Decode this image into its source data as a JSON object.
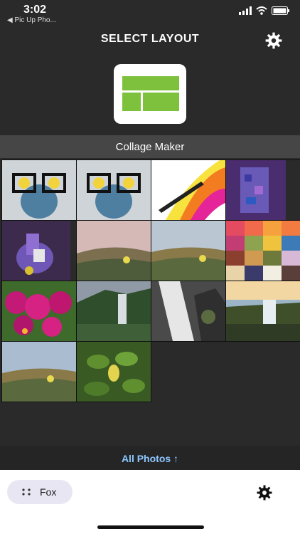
{
  "status": {
    "time": "3:02",
    "back_app": "◀ Pic Up Pho..."
  },
  "header": {
    "title": "SELECT LAYOUT"
  },
  "section": {
    "title": "Collage Maker"
  },
  "photos": [
    {
      "name": "frog-glasses-1"
    },
    {
      "name": "frog-glasses-2"
    },
    {
      "name": "pen-rainbow"
    },
    {
      "name": "purple-pixel-art"
    },
    {
      "name": "llama-toy"
    },
    {
      "name": "coastal-hill-1"
    },
    {
      "name": "coastal-hill-2"
    },
    {
      "name": "color-palette"
    },
    {
      "name": "pink-flowers"
    },
    {
      "name": "waterfall-mist"
    },
    {
      "name": "waterfall-rocks"
    },
    {
      "name": "waterfall-sunset"
    },
    {
      "name": "coastal-hill-3"
    },
    {
      "name": "green-leaves"
    }
  ],
  "footer": {
    "all_photos_label": "All Photos ↑"
  },
  "bottom": {
    "fox_label": "Fox"
  },
  "colors": {
    "accent_green": "#7ec13c",
    "link_blue": "#8cc7ff",
    "dark_bg": "#2a2a2a",
    "section_bg": "#464646"
  }
}
